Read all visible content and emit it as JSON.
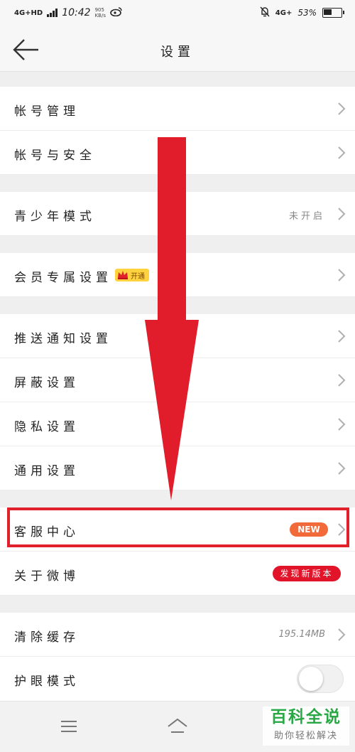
{
  "status_bar": {
    "network": "4G+HD",
    "time": "10:42",
    "speed_value": "905",
    "speed_unit": "KB/s",
    "weibo_icon": "weibo-logo-icon",
    "battery_percent": "53%",
    "right_network": "4G+",
    "battery_level": 0.53
  },
  "header": {
    "back_icon": "arrow-left-icon",
    "title": "设置"
  },
  "groups": [
    {
      "items": [
        {
          "label": "帐号管理"
        },
        {
          "label": "帐号与安全"
        }
      ]
    },
    {
      "items": [
        {
          "label": "青少年模式",
          "value": "未开启"
        }
      ]
    },
    {
      "items": [
        {
          "label": "会员专属设置",
          "badge": "开通",
          "badge_icon": "crown-icon"
        }
      ]
    },
    {
      "items": [
        {
          "label": "推送通知设置"
        },
        {
          "label": "屏蔽设置"
        },
        {
          "label": "隐私设置"
        },
        {
          "label": "通用设置"
        }
      ]
    },
    {
      "items": [
        {
          "label": "客服中心",
          "badge": "NEW"
        },
        {
          "label": "关于微博",
          "badge": "发现新版本"
        }
      ]
    },
    {
      "items": [
        {
          "label": "清除缓存",
          "value": "195.14MB"
        },
        {
          "label": "护眼模式",
          "toggle_on": false
        }
      ]
    }
  ],
  "nav_bar": {
    "menu_icon": "menu-icon",
    "home_icon": "home-icon"
  },
  "watermark": {
    "title": "百科全说",
    "subtitle": "助你轻松解决"
  },
  "colors": {
    "annotation_red": "#e0202a",
    "new_badge": "#f26a3a",
    "version_badge": "#e2142a",
    "vip_badge": "#ffd23f",
    "watermark_green": "#2aa845"
  }
}
